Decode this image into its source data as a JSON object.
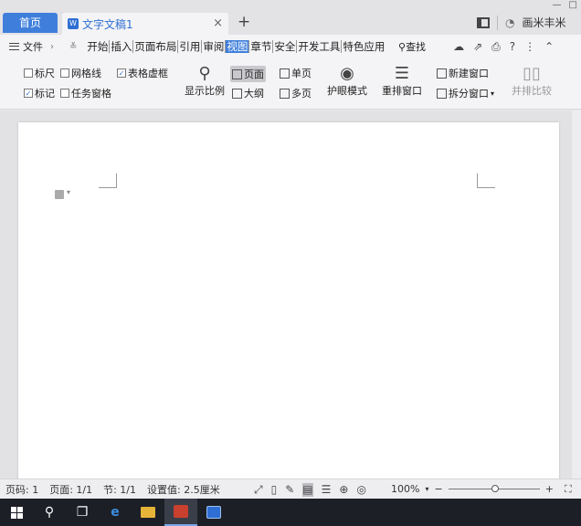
{
  "tabs": {
    "home": "首页",
    "document": "文字文稿1",
    "close": "×",
    "new": "+"
  },
  "titlebar": {
    "user": "画米丰米"
  },
  "menu": {
    "file": "文件",
    "tabs": [
      "开始",
      "插入",
      "页面布局",
      "引用",
      "审阅",
      "视图",
      "章节",
      "安全",
      "开发工具",
      "特色应用"
    ],
    "active_tab": "视图",
    "search": "查找"
  },
  "ribbon": {
    "ruler": "标尺",
    "gridlines": "网格线",
    "table_gridlines": "表格虚框",
    "marks": "标记",
    "task_pane": "任务窗格",
    "zoom": "显示比例",
    "print_layout": "页面",
    "outline": "大纲",
    "single_page": "单页",
    "multi_page": "多页",
    "reading_mode": "护眼模式",
    "arrange_windows": "重排窗口",
    "new_window": "新建窗口",
    "split_window": "拆分窗口",
    "side_by_side": "并排比较"
  },
  "status": {
    "page_num": "页码: 1",
    "pages": "页面: 1/1",
    "section": "节: 1/1",
    "setting": "设置值: 2.5厘米",
    "zoom": "100%"
  },
  "colors": {
    "accent": "#3f7fdb",
    "taskbar": "#1c1f26"
  }
}
